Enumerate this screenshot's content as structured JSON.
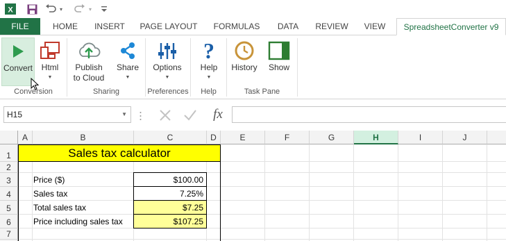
{
  "ribbon": {
    "tabs": [
      "FILE",
      "HOME",
      "INSERT",
      "PAGE LAYOUT",
      "FORMULAS",
      "DATA",
      "REVIEW",
      "VIEW",
      "SpreadsheetConverter v9"
    ],
    "buttons": {
      "convert": "Convert",
      "html": "Html",
      "publish_line1": "Publish",
      "publish_line2": "to Cloud",
      "share": "Share",
      "options": "Options",
      "help": "Help",
      "history": "History",
      "show": "Show"
    },
    "groups": {
      "conversion": "Conversion",
      "sharing": "Sharing",
      "preferences": "Preferences",
      "help": "Help",
      "task_pane": "Task Pane"
    }
  },
  "formula_bar": {
    "name_box": "H15",
    "fx": "fx",
    "content": ""
  },
  "sheet": {
    "columns": [
      "A",
      "B",
      "C",
      "D",
      "E",
      "F",
      "G",
      "H",
      "I",
      "J"
    ],
    "rows": [
      "1",
      "2",
      "3",
      "4",
      "5",
      "6",
      "7"
    ],
    "title": "Sales tax calculator",
    "labels": {
      "price": "Price ($)",
      "sales_tax": "Sales tax",
      "total_sales_tax": "Total sales tax",
      "price_incl": "Price including sales tax"
    },
    "values": {
      "price": "$100.00",
      "sales_tax": "7.25%",
      "total_sales_tax": "$7.25",
      "price_incl": "$107.25"
    }
  },
  "colors": {
    "excel_green": "#217346",
    "title_fill": "#ffff00",
    "output_fill": "#ffff99",
    "selected_col": "#d3f0e0"
  }
}
